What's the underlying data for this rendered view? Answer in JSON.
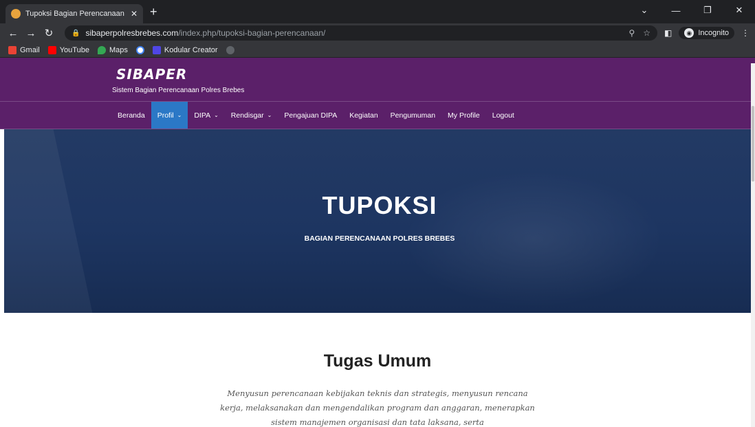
{
  "browser": {
    "tab_title": "Tupoksi Bagian Perencanaan – Si",
    "url_host": "sibaperpolresbrebes.com",
    "url_path": "/index.php/tupoksi-bagian-perencanaan/",
    "incognito_label": "Incognito",
    "bookmarks": [
      "Gmail",
      "YouTube",
      "Maps",
      "",
      "Kodular Creator",
      ""
    ]
  },
  "site": {
    "logo": "SIBAPER",
    "tagline": "Sistem Bagian Perencanaan Polres Brebes",
    "nav": [
      {
        "label": "Beranda"
      },
      {
        "label": "Profil"
      },
      {
        "label": "DIPA"
      },
      {
        "label": "Rendisgar"
      },
      {
        "label": "Pengajuan DIPA"
      },
      {
        "label": "Kegiatan"
      },
      {
        "label": "Pengumuman"
      },
      {
        "label": "My Profile"
      },
      {
        "label": "Logout"
      }
    ]
  },
  "hero": {
    "title": "TUPOKSI",
    "subtitle": "BAGIAN PERENCANAAN POLRES BREBES"
  },
  "section": {
    "title": "Tugas Umum",
    "text": "Menyusun perencanaan kebijakan teknis dan strategis, menyusun rencana kerja, melaksanakan dan mengendalikan program dan anggaran, menerapkan sistem manajemen organisasi dan tata laksana, serta"
  },
  "colors": {
    "header_purple": "#5b2069",
    "nav_active": "#2b78c6",
    "hero_navy": "#1d3561"
  }
}
